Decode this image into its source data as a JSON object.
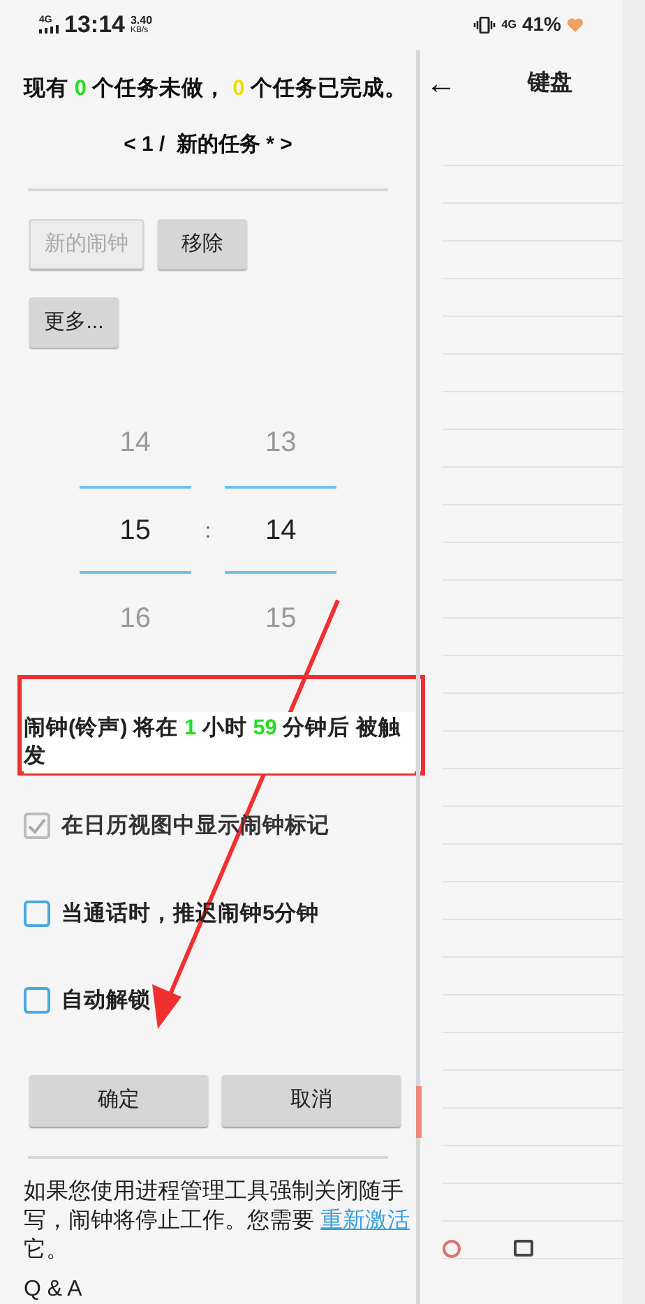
{
  "status_bar": {
    "network": "4G",
    "time": "13:14",
    "speed": "3.40",
    "speed_unit": "KB/s",
    "signal_label": "4G",
    "battery": "41%"
  },
  "summary": {
    "prefix": "现有",
    "todo_count": "0",
    "middle": "个任务未做，",
    "done_count": "0",
    "suffix": "个任务已完成。"
  },
  "nav": {
    "text": "< 1 /  新的任务 * >"
  },
  "alarm_buttons": [
    {
      "label": "新的闹钟",
      "disabled": true
    },
    {
      "label": "移除",
      "disabled": false
    },
    {
      "label": "更多...",
      "disabled": false
    }
  ],
  "picker": {
    "separator": ":",
    "columns": [
      {
        "values": [
          {
            "text": "14",
            "selected": false
          },
          {
            "text": "15",
            "selected": true
          },
          {
            "text": "16",
            "selected": false
          }
        ]
      },
      {
        "values": [
          {
            "text": "13",
            "selected": false
          },
          {
            "text": "14",
            "selected": true
          },
          {
            "text": "15",
            "selected": false
          }
        ]
      }
    ]
  },
  "countdown": {
    "prefix": "闹钟(铃声) 将在",
    "hours": "1",
    "hour_unit": "小时",
    "minutes": "59",
    "suffix": "分钟后 被触发"
  },
  "options": [
    {
      "label": "在日历视图中显示闹钟标记",
      "checked": true,
      "disabled": true
    },
    {
      "label": "当通话时，推迟闹钟5分钟",
      "checked": false,
      "disabled": false
    },
    {
      "label": "自动解锁",
      "checked": false,
      "disabled": false
    }
  ],
  "actions": [
    "确定",
    "取消"
  ],
  "notice": {
    "text": "如果您使用进程管理工具强制关闭随手写，闹钟将停止工作。您需要",
    "link": "重新激活",
    "after": "它。"
  },
  "qa_heading": "Q & A",
  "side_panel": {
    "back": "←",
    "title": "键盘"
  }
}
